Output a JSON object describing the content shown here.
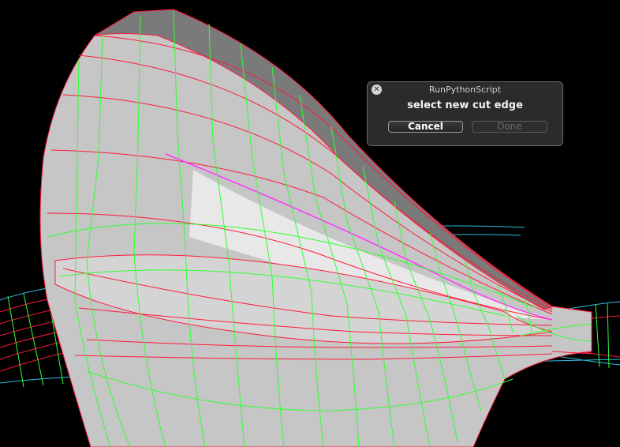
{
  "viewport": {
    "description_icon": "3d-surface-model",
    "colors": {
      "background": "#000000",
      "surface": "#c8c8c8",
      "surface_dark": "#7a7a7a",
      "surface_light": "#e6e6e6",
      "edge_red": "#ff1a3c",
      "edge_green": "#33ff33",
      "edge_magenta": "#ff33ff",
      "edge_cyan": "#33bbdd"
    }
  },
  "dialog": {
    "title": "RunPythonScript",
    "message": "select new cut edge",
    "close_icon": "close-icon",
    "buttons": {
      "cancel_label": "Cancel",
      "done_label": "Done"
    }
  }
}
